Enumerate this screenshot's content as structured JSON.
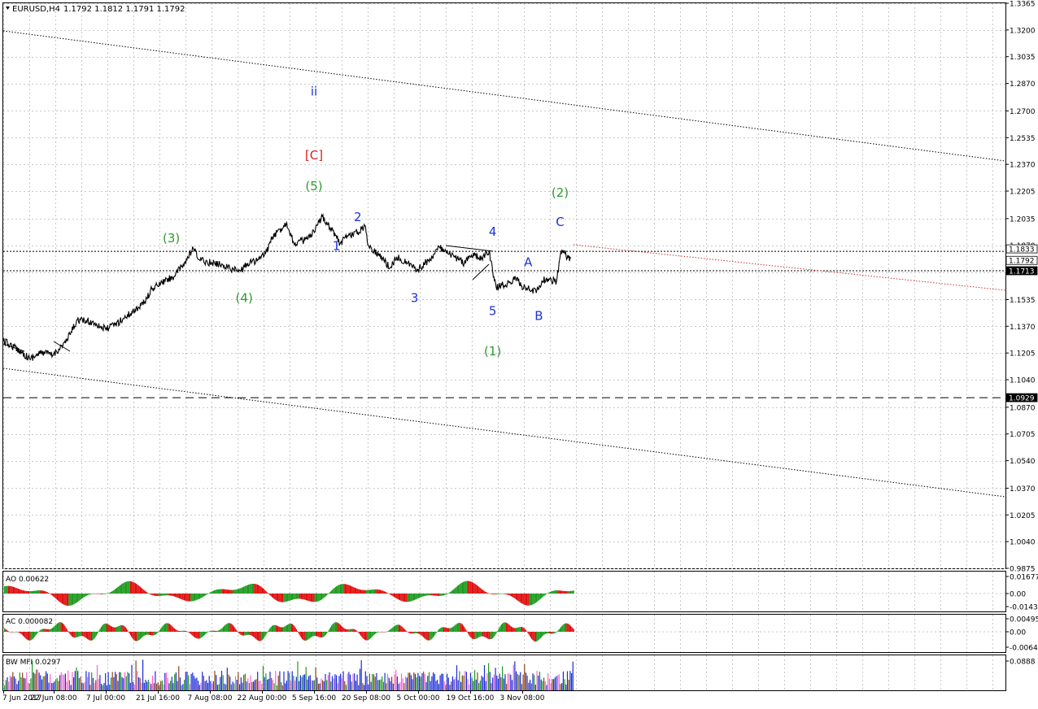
{
  "chart_data": [
    {
      "type": "line",
      "panel": "main",
      "symbol_label": "EURUSD,H4",
      "ohlc_label": "1.1792 1.1812 1.1791 1.1792",
      "yaxis": {
        "ticks": [
          "1.3365",
          "1.3200",
          "1.3035",
          "1.2870",
          "1.2700",
          "1.2535",
          "1.2370",
          "1.2205",
          "1.2035",
          "1.1870",
          "1.1705",
          "1.1535",
          "1.1370",
          "1.1205",
          "1.1040",
          "1.0870",
          "1.0705",
          "1.0540",
          "1.0370",
          "1.0205",
          "1.0040",
          "0.9875"
        ],
        "ylim": [
          0.9875,
          1.3365
        ]
      },
      "xaxis": {
        "ticks": [
          "7 Jun 2017",
          "22 Jun 08:00",
          "7 Jul 00:00",
          "21 Jul 16:00",
          "7 Aug 08:00",
          "22 Aug 00:00",
          "5 Sep 16:00",
          "20 Sep 08:00",
          "5 Oct 00:00",
          "19 Oct 16:00",
          "3 Nov 08:00"
        ]
      },
      "price_tags": [
        "1.1833",
        "1.1792",
        "1.1713",
        "1.0929"
      ],
      "price_series": [
        [
          "7 Jun 2017",
          1.128
        ],
        [
          "12 Jun",
          1.122
        ],
        [
          "15 Jun",
          1.117
        ],
        [
          "19 Jun",
          1.121
        ],
        [
          "22 Jun",
          1.119
        ],
        [
          "26 Jun",
          1.128
        ],
        [
          "29 Jun",
          1.141
        ],
        [
          "4 Jul",
          1.139
        ],
        [
          "7 Jul",
          1.135
        ],
        [
          "11 Jul",
          1.14
        ],
        [
          "14 Jul",
          1.145
        ],
        [
          "18 Jul",
          1.152
        ],
        [
          "20 Jul",
          1.16
        ],
        [
          "24 Jul",
          1.165
        ],
        [
          "27 Jul",
          1.168
        ],
        [
          "31 Jul",
          1.178
        ],
        [
          "2 Aug",
          1.185
        ],
        [
          "4 Aug",
          1.178
        ],
        [
          "8 Aug",
          1.176
        ],
        [
          "11 Aug",
          1.175
        ],
        [
          "14 Aug",
          1.172
        ],
        [
          "16 Aug",
          1.171
        ],
        [
          "18 Aug",
          1.176
        ],
        [
          "21 Aug",
          1.178
        ],
        [
          "23 Aug",
          1.182
        ],
        [
          "25 Aug",
          1.192
        ],
        [
          "29 Aug",
          1.201
        ],
        [
          "31 Aug",
          1.188
        ],
        [
          "4 Sep",
          1.191
        ],
        [
          "6 Sep",
          1.196
        ],
        [
          "8 Sep",
          1.205
        ],
        [
          "11 Sep",
          1.196
        ],
        [
          "13 Sep",
          1.188
        ],
        [
          "15 Sep",
          1.193
        ],
        [
          "18 Sep",
          1.195
        ],
        [
          "20 Sep",
          1.199
        ],
        [
          "21 Sep",
          1.187
        ],
        [
          "25 Sep",
          1.179
        ],
        [
          "27 Sep",
          1.173
        ],
        [
          "29 Sep",
          1.18
        ],
        [
          "2 Oct",
          1.176
        ],
        [
          "5 Oct",
          1.172
        ],
        [
          "9 Oct",
          1.18
        ],
        [
          "11 Oct",
          1.186
        ],
        [
          "13 Oct",
          1.182
        ],
        [
          "16 Oct",
          1.179
        ],
        [
          "18 Oct",
          1.176
        ],
        [
          "20 Oct",
          1.181
        ],
        [
          "23 Oct",
          1.179
        ],
        [
          "25 Oct",
          1.183
        ],
        [
          "26 Oct",
          1.171
        ],
        [
          "27 Oct",
          1.161
        ],
        [
          "31 Oct",
          1.164
        ],
        [
          "2 Nov",
          1.167
        ],
        [
          "3 Nov",
          1.162
        ],
        [
          "6 Nov",
          1.159
        ],
        [
          "8 Nov",
          1.16
        ],
        [
          "9 Nov",
          1.165
        ],
        [
          "10 Nov",
          1.166
        ],
        [
          "13 Nov",
          1.165
        ],
        [
          "14 Nov",
          1.18
        ],
        [
          "15 Nov",
          1.184
        ],
        [
          "16 Nov",
          1.179
        ],
        [
          "17 Nov",
          1.179
        ]
      ],
      "wave_labels": [
        {
          "text": "ii",
          "color": "#1b34d8",
          "price": 1.282,
          "date": "5 Sep 16:00"
        },
        {
          "text": "[C]",
          "color": "#e02020",
          "price": 1.2425,
          "date": "5 Sep 16:00"
        },
        {
          "text": "(5)",
          "color": "#2e9a2e",
          "price": 1.2235,
          "date": "5 Sep 16:00"
        },
        {
          "text": "(3)",
          "color": "#2e9a2e",
          "price": 1.1915,
          "date": "26 Jul"
        },
        {
          "text": "(4)",
          "color": "#2e9a2e",
          "price": 1.1545,
          "date": "17 Aug"
        },
        {
          "text": "1",
          "color": "#1b34d8",
          "price": 1.1865,
          "date": "12 Sep"
        },
        {
          "text": "2",
          "color": "#1b34d8",
          "price": 1.2045,
          "date": "18 Sep"
        },
        {
          "text": "3",
          "color": "#1b34d8",
          "price": 1.1545,
          "date": "4 Oct"
        },
        {
          "text": "4",
          "color": "#1b34d8",
          "price": 1.1955,
          "date": "26 Oct"
        },
        {
          "text": "5",
          "color": "#1b34d8",
          "price": 1.1465,
          "date": "26 Oct"
        },
        {
          "text": "(1)",
          "color": "#2e9a2e",
          "price": 1.1215,
          "date": "26 Oct"
        },
        {
          "text": "A",
          "color": "#1b34d8",
          "price": 1.1765,
          "date": "5 Nov"
        },
        {
          "text": "B",
          "color": "#1b34d8",
          "price": 1.1435,
          "date": "8 Nov"
        },
        {
          "text": "C",
          "color": "#1b34d8",
          "price": 1.2015,
          "date": "14 Nov"
        },
        {
          "text": "(2)",
          "color": "#2e9a2e",
          "price": 1.2195,
          "date": "14 Nov"
        }
      ],
      "colors": {
        "background": "#ffffff",
        "price": "#000000",
        "grid": "#c0c0c0",
        "forecast": "#d03030"
      },
      "grid": true
    },
    {
      "type": "bar",
      "panel": "AO",
      "label": "AO 0.00622",
      "yaxis": {
        "ticks": [
          "0.01677",
          "0.00",
          "-0.01435"
        ]
      },
      "colors": {
        "up": "#1f9a1f",
        "down": "#e01010"
      }
    },
    {
      "type": "bar",
      "panel": "AC",
      "label": "AC 0.000082",
      "yaxis": {
        "ticks": [
          "0.00495",
          "0.00",
          "-0.00641"
        ]
      },
      "colors": {
        "up": "#1f9a1f",
        "down": "#e01010"
      }
    },
    {
      "type": "bar",
      "panel": "BW MFI",
      "label": "BW MFI 0.0297",
      "yaxis": {
        "ticks": [
          "0.0888"
        ]
      },
      "colors": {
        "green": "#1f9a1f",
        "blue": "#1b2bd8",
        "brown": "#8b4513",
        "pink": "#ff66cc"
      }
    }
  ]
}
